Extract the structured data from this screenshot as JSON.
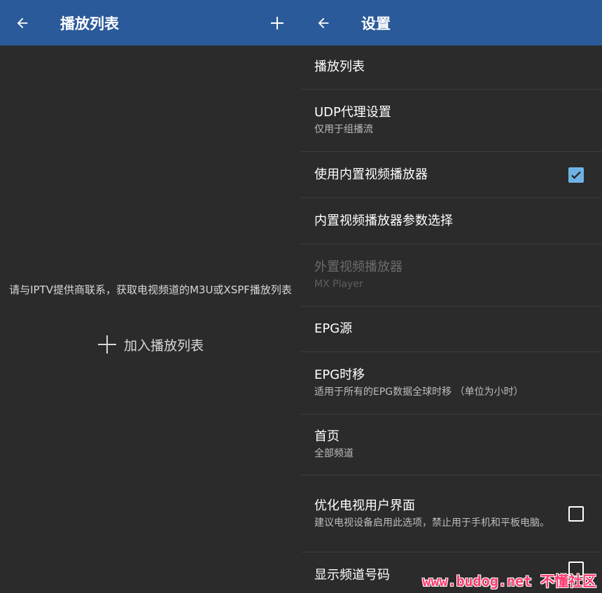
{
  "left": {
    "appbar": {
      "title": "播放列表",
      "back_icon": "arrow-left-icon",
      "add_icon": "plus-icon"
    },
    "empty_message": "请与IPTV提供商联系，获取电视频道的M3U或XSPF播放列表",
    "add_playlist_label": "加入播放列表"
  },
  "right": {
    "appbar": {
      "title": "设置",
      "back_icon": "arrow-left-icon"
    },
    "items": [
      {
        "primary": "播放列表"
      },
      {
        "primary": "UDP代理设置",
        "secondary": "仅用于组播流"
      },
      {
        "primary": "使用内置视频播放器",
        "checkbox": true,
        "checked": true
      },
      {
        "primary": "内置视频播放器参数选择"
      },
      {
        "primary": "外置视频播放器",
        "secondary": "MX Player",
        "disabled": true
      },
      {
        "primary": "EPG源"
      },
      {
        "primary": "EPG时移",
        "secondary": "适用于所有的EPG数据全球时移 （单位为小时）"
      },
      {
        "primary": "首页",
        "secondary": "全部频道"
      },
      {
        "primary": "优化电视用户界面",
        "secondary": "建议电视设备启用此选项，禁止用于手机和平板电脑。",
        "checkbox": true,
        "checked": false
      },
      {
        "primary": "显示频道号码",
        "checkbox": true,
        "checked": false
      }
    ]
  },
  "watermark": "www.budog.net 不懂社区",
  "colors": {
    "appbar": "#2b5a9a",
    "background": "#2b2b2b",
    "check_accent": "#6fb3e6",
    "divider": "#3d3d3d"
  }
}
